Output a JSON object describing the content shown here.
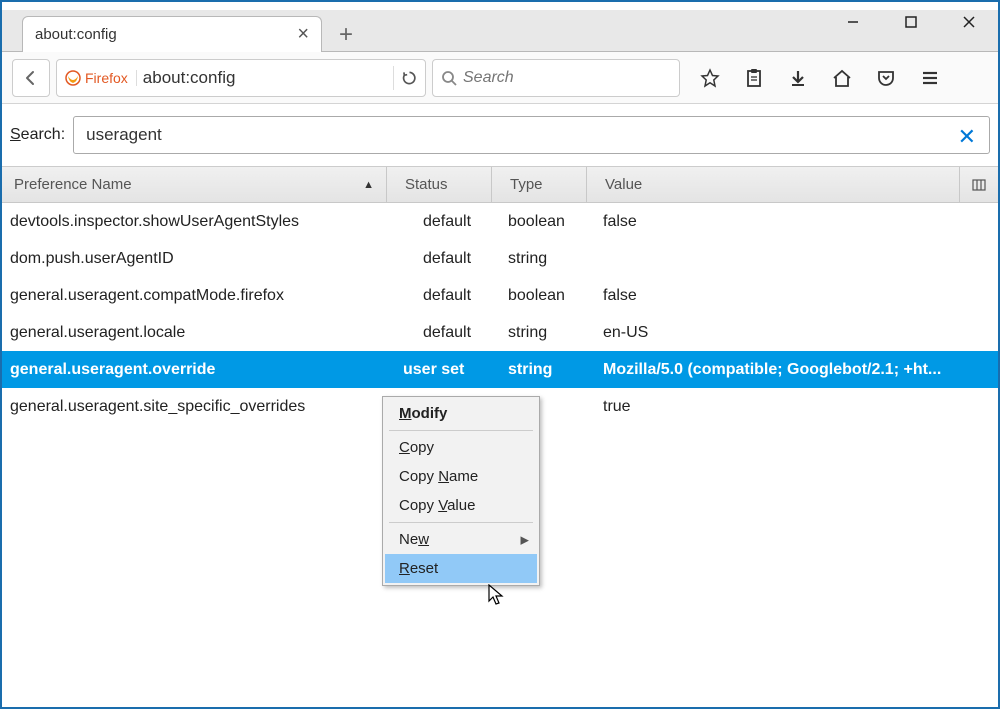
{
  "window": {
    "tab_title": "about:config"
  },
  "navbar": {
    "identity_text": "Firefox",
    "url": "about:config",
    "search_placeholder": "Search"
  },
  "config": {
    "search_label": "Search:",
    "search_value": "useragent",
    "columns": {
      "name": "Preference Name",
      "status": "Status",
      "type": "Type",
      "value": "Value"
    },
    "rows": [
      {
        "name": "devtools.inspector.showUserAgentStyles",
        "status": "default",
        "type": "boolean",
        "value": "false",
        "sel": false
      },
      {
        "name": "dom.push.userAgentID",
        "status": "default",
        "type": "string",
        "value": "",
        "sel": false
      },
      {
        "name": "general.useragent.compatMode.firefox",
        "status": "default",
        "type": "boolean",
        "value": "false",
        "sel": false
      },
      {
        "name": "general.useragent.locale",
        "status": "default",
        "type": "string",
        "value": "en-US",
        "sel": false
      },
      {
        "name": "general.useragent.override",
        "status": "user set",
        "type": "string",
        "value": "Mozilla/5.0 (compatible; Googlebot/2.1; +ht...",
        "sel": true
      },
      {
        "name": "general.useragent.site_specific_overrides",
        "status": "",
        "type": "ean",
        "value": "true",
        "sel": false
      }
    ]
  },
  "context_menu": {
    "modify": "Modify",
    "copy": "Copy",
    "copy_name": "Copy Name",
    "copy_value": "Copy Value",
    "new": "New",
    "reset": "Reset"
  }
}
